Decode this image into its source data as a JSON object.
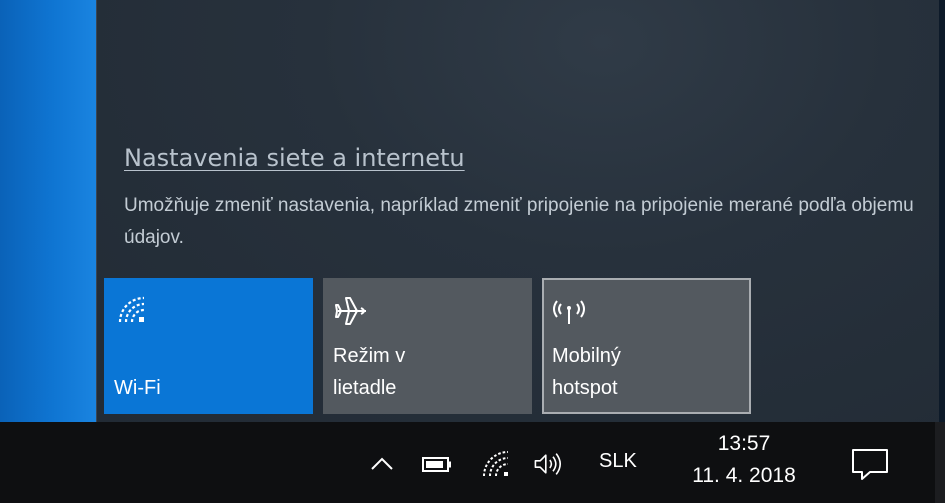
{
  "flyout": {
    "settings_link": "Nastavenia siete a internetu",
    "settings_description": "Umožňuje zmeniť nastavenia, napríklad zmeniť pripojenie na pripojenie merané podľa objemu údajov."
  },
  "quick_actions": [
    {
      "label": "Wi-Fi",
      "icon": "wifi-icon",
      "active": true
    },
    {
      "label": "Režim v\nlietadle",
      "icon": "airplane-icon",
      "active": false
    },
    {
      "label": "Mobilný\nhotspot",
      "icon": "hotspot-icon",
      "active": false
    }
  ],
  "taskbar": {
    "tray_icons": [
      "chevron-up-icon",
      "battery-icon",
      "wifi-icon",
      "volume-icon"
    ],
    "language": "SLK",
    "time": "13:57",
    "date": "11. 4. 2018",
    "notification_icon": "action-center-icon"
  },
  "colors": {
    "accent": "#0a76d6",
    "tile_inactive": "#53595f",
    "flyout_bg": "#27313c",
    "taskbar_bg": "#0e0f11"
  }
}
